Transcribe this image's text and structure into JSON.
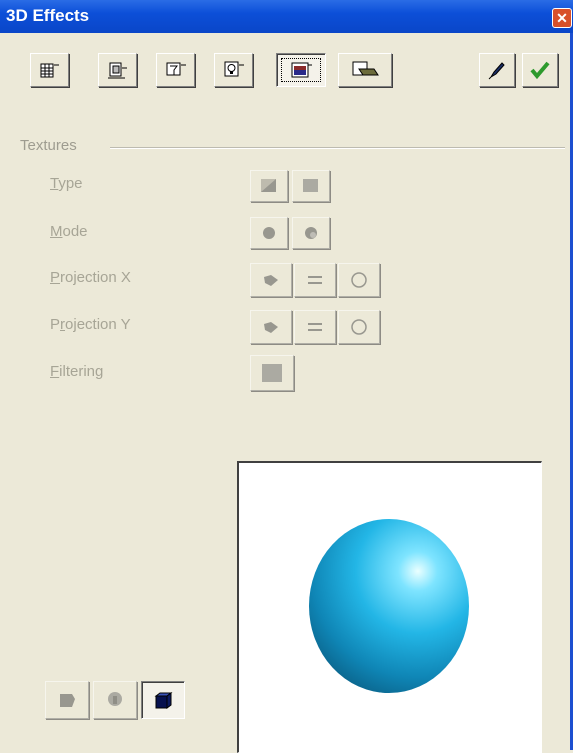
{
  "window": {
    "title": "3D Effects",
    "close_glyph": "✕"
  },
  "toolbar": {
    "tabs": [
      {
        "name": "geometry-tab",
        "icon": "geometry-icon"
      },
      {
        "name": "shading-tab",
        "icon": "shading-icon"
      },
      {
        "name": "illumination-tab",
        "icon": "illumination-icon"
      },
      {
        "name": "lighting-tab",
        "icon": "light-bulb-icon"
      },
      {
        "name": "textures-tab",
        "icon": "textures-icon",
        "selected": true
      },
      {
        "name": "material-tab",
        "icon": "material-icon"
      }
    ],
    "actions": [
      {
        "name": "pick-3d-object-button",
        "icon": "pen-icon"
      },
      {
        "name": "assign-button",
        "icon": "checkmark-icon"
      }
    ]
  },
  "textures": {
    "group_label": "Textures",
    "type_label": "Type",
    "type_ul": "T",
    "mode_label": "Mode",
    "mode_ul": "M",
    "projx_label": "Projection X",
    "projx_ul": "P",
    "projy_label": "Projection Y",
    "projy_ul": "r",
    "filtering_label": "Filtering",
    "filtering_ul": "F"
  },
  "bottom": {
    "buttons": [
      {
        "name": "2d-shape-button",
        "icon": "flat-shape-icon"
      },
      {
        "name": "rotation-object-button",
        "icon": "lathe-icon"
      },
      {
        "name": "3d-cube-button",
        "icon": "cube-icon",
        "pressed": true
      }
    ]
  },
  "colors": {
    "accent": "#0a46c8",
    "disabled_text": "#a7a596",
    "sphere": "#18a8dc"
  }
}
